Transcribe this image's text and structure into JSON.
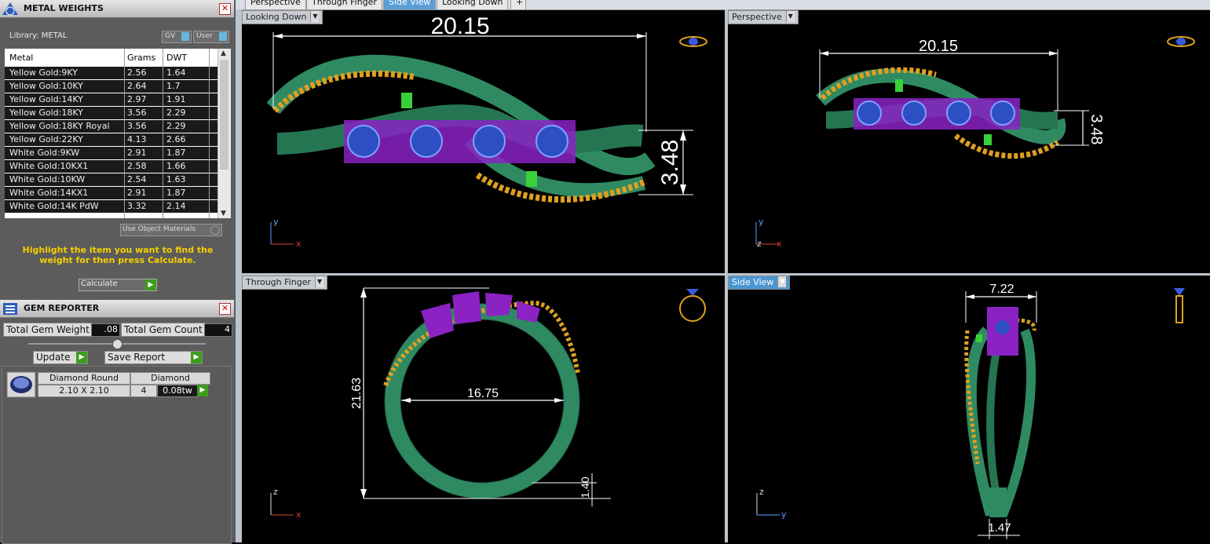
{
  "metal_panel": {
    "title": "METAL WEIGHTS",
    "library_label": "Library: METAL",
    "gv_label": "GV",
    "user_label": "User",
    "columns": [
      "Metal",
      "Grams",
      "DWT"
    ],
    "rows": [
      {
        "metal": "Yellow Gold:9KY",
        "grams": "2.56",
        "dwt": "1.64"
      },
      {
        "metal": "Yellow Gold:10KY",
        "grams": "2.64",
        "dwt": "1.7"
      },
      {
        "metal": "Yellow Gold:14KY",
        "grams": "2.97",
        "dwt": "1.91"
      },
      {
        "metal": "Yellow Gold:18KY",
        "grams": "3.56",
        "dwt": "2.29"
      },
      {
        "metal": "Yellow Gold:18KY Royal",
        "grams": "3.56",
        "dwt": "2.29"
      },
      {
        "metal": "Yellow Gold:22KY",
        "grams": "4.13",
        "dwt": "2.66"
      },
      {
        "metal": "White Gold:9KW",
        "grams": "2.91",
        "dwt": "1.87"
      },
      {
        "metal": "White Gold:10KX1",
        "grams": "2.58",
        "dwt": "1.66"
      },
      {
        "metal": "White Gold:10KW",
        "grams": "2.54",
        "dwt": "1.63"
      },
      {
        "metal": "White Gold:14KX1",
        "grams": "2.91",
        "dwt": "1.87"
      },
      {
        "metal": "White Gold:14K PdW",
        "grams": "3.32",
        "dwt": "2.14"
      }
    ],
    "use_object_materials": "Use Object Materials",
    "instruction": "Highlight the item you want to find the weight for then press Calculate.",
    "calculate_label": "Calculate"
  },
  "gem_panel": {
    "title": "GEM REPORTER",
    "total_weight_label": "Total Gem Weight",
    "total_weight_value": ".08",
    "total_count_label": "Total Gem Count",
    "total_count_value": "4",
    "update_label": "Update",
    "save_report_label": "Save Report",
    "gem": {
      "shape": "Diamond Round",
      "material": "Diamond",
      "size": "2.10 X 2.10",
      "count": "4",
      "weight": "0.08tw"
    }
  },
  "tabs": [
    "Perspective",
    "Through Finger",
    "Side View",
    "Looking Down"
  ],
  "active_tab": "Side View",
  "viewports": {
    "top_left": {
      "label": "Looking Down",
      "dim_width": "20.15",
      "dim_height": "3.48",
      "axis_v": "y",
      "axis_h": "x"
    },
    "top_right": {
      "label": "Perspective",
      "dim_width": "20.15",
      "dim_height": "3.48",
      "axis_v": "y",
      "axis_h": "x",
      "axis_z": "z"
    },
    "bottom_left": {
      "label": "Through Finger",
      "dim_height": "21.63",
      "dim_inner": "16.75",
      "dim_thickness": "1.40",
      "axis_v": "z",
      "axis_h": "x"
    },
    "bottom_right": {
      "label": "Side View",
      "dim_top": "7.22",
      "dim_bottom": "1.47",
      "axis_v": "z",
      "axis_h": "y"
    }
  },
  "colors": {
    "band": "#2f8a62",
    "gold_beads": "#e0a020",
    "settings": "#9d2bd0",
    "stones": "#2d4fc4",
    "accent": "#4d97d1"
  }
}
